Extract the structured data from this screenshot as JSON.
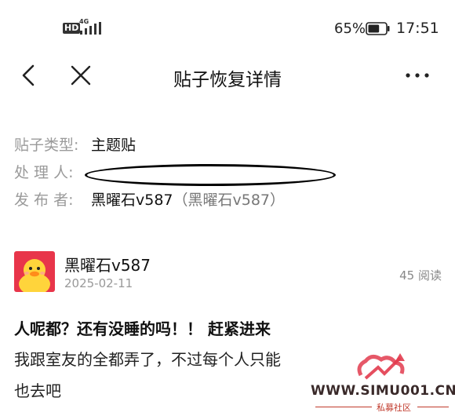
{
  "status_bar": {
    "hd": "HD",
    "network": "4G",
    "battery_percent": "65%",
    "time": "17:51",
    "battery_level": 0.65
  },
  "nav": {
    "title": "贴子恢复详情"
  },
  "info": {
    "type_label": "贴子类型:",
    "type_value": "主题贴",
    "handler_label": "处 理 人:",
    "publisher_label": "发 布 者:",
    "publisher_value": "黑曜石v587",
    "publisher_sub": "（黑曜石v587）"
  },
  "post": {
    "author": "黑曜石v587",
    "date": "2025-02-11",
    "reads": "45 阅读",
    "title": "人呢都？还有没睡的吗！！ 赶紧进来",
    "body_line1": "我跟室友的全都弄了，不过每个人只能",
    "body_line2": "也去吧"
  },
  "watermark": {
    "text": "WWW.SIMU001.CN",
    "sub": "私募社区"
  },
  "colors": {
    "label_gray": "#9a9a9a",
    "watermark_red": "#c0392b"
  }
}
